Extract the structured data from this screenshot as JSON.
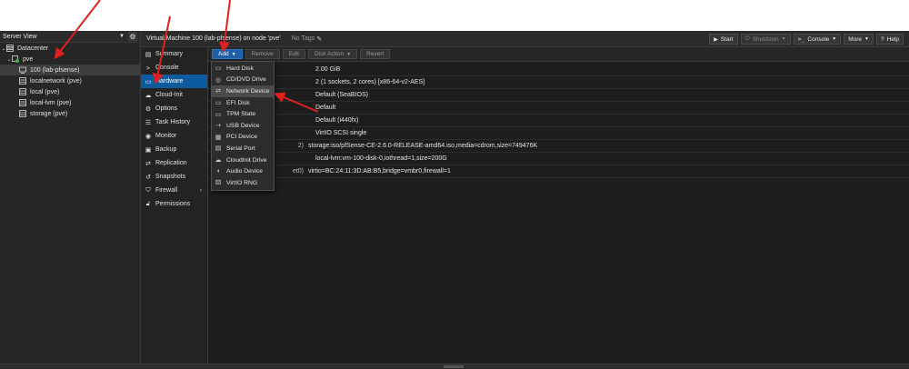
{
  "left_panel": {
    "view_label": "Server View",
    "tree": [
      {
        "label": "Datacenter",
        "icon": "datacenter-icon"
      },
      {
        "label": "pve",
        "icon": "node-icon"
      },
      {
        "label": "100 (lab-pfsense)",
        "icon": "vm-icon"
      },
      {
        "label": "localnetwork (pve)",
        "icon": "storage-icon"
      },
      {
        "label": "local (pve)",
        "icon": "storage-icon"
      },
      {
        "label": "local-lvm (pve)",
        "icon": "storage-icon"
      },
      {
        "label": "storage (pve)",
        "icon": "storage-icon"
      }
    ]
  },
  "header": {
    "title": "Virtual Machine 100 (lab-pfsense) on node 'pve'",
    "tags": "No Tags",
    "buttons": {
      "start": "Start",
      "shutdown": "Shutdown",
      "console": "Console",
      "more": "More",
      "help": "Help"
    }
  },
  "nav": [
    "Summary",
    "Console",
    "Hardware",
    "Cloud-Init",
    "Options",
    "Task History",
    "Monitor",
    "Backup",
    "Replication",
    "Snapshots",
    "Firewall",
    "Permissions"
  ],
  "hw_toolbar": {
    "add": "Add",
    "remove": "Remove",
    "edit": "Edit",
    "disk_action": "Disk Action",
    "revert": "Revert"
  },
  "hardware_rows": [
    {
      "key": "",
      "value": "2.00 GiB"
    },
    {
      "key": "",
      "value": "2 (1 sockets, 2 cores) [x86-64-v2-AES]"
    },
    {
      "key": "",
      "value": "Default (SeaBIOS)"
    },
    {
      "key": "",
      "value": "Default"
    },
    {
      "key": "",
      "value": "Default (i440fx)"
    },
    {
      "key": "",
      "value": "VirtIO SCSI single"
    },
    {
      "key": "2)",
      "value": "storage:iso/pfSense-CE-2.6.0-RELEASE-amd64.iso,media=cdrom,size=749476K"
    },
    {
      "key": "",
      "value": "local-lvm:vm-100-disk-0,iothread=1,size=200G"
    },
    {
      "key": "et0)",
      "value": "virtio=BC:24:11:3D:AB:B5,bridge=vmbr0,firewall=1"
    }
  ],
  "add_menu": [
    "Hard Disk",
    "CD/DVD Drive",
    "Network Device",
    "EFI Disk",
    "TPM State",
    "USB Device",
    "PCI Device",
    "Serial Port",
    "CloudInit Drive",
    "Audio Device",
    "VirtIO RNG"
  ],
  "colors": {
    "accent": "#0e5a9e",
    "arrow": "#e02020",
    "node_ok": "#3cb043"
  }
}
